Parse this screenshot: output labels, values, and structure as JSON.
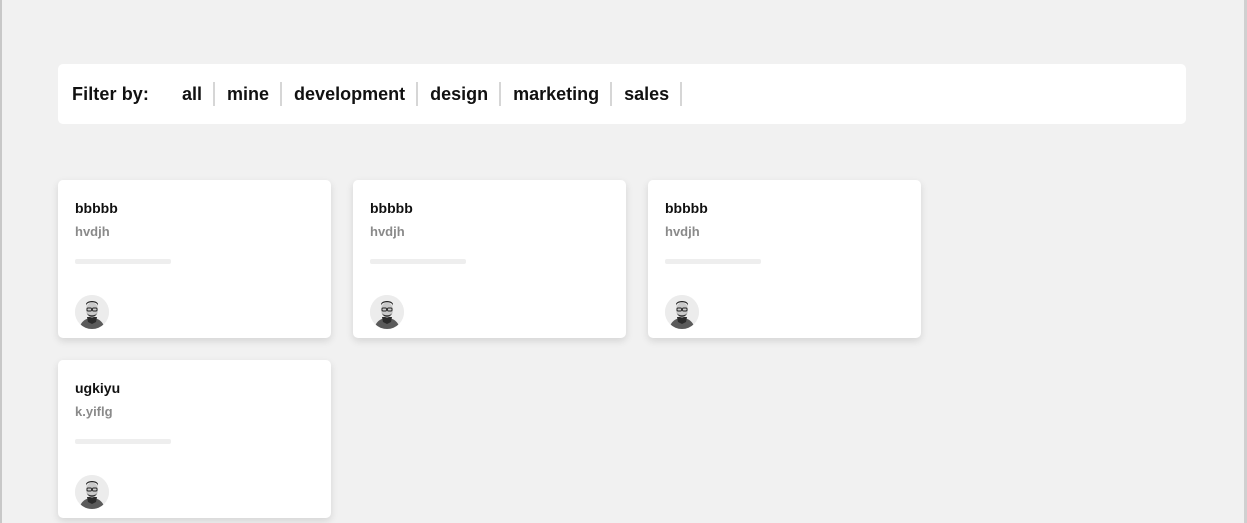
{
  "filter": {
    "label": "Filter by:",
    "options": [
      "all",
      "mine",
      "development",
      "design",
      "marketing",
      "sales"
    ]
  },
  "cards": [
    {
      "title": "bbbbb",
      "subtitle": "hvdjh",
      "avatar_icon": "user-avatar-icon"
    },
    {
      "title": "bbbbb",
      "subtitle": "hvdjh",
      "avatar_icon": "user-avatar-icon"
    },
    {
      "title": "bbbbb",
      "subtitle": "hvdjh",
      "avatar_icon": "user-avatar-icon"
    },
    {
      "title": "ugkiyu",
      "subtitle": "k.yiflg",
      "avatar_icon": "user-avatar-icon"
    }
  ],
  "colors": {
    "background": "#f1f1f1",
    "panel": "#ffffff",
    "subtitle": "#8a8a8a",
    "divider": "#d6d6d6"
  }
}
